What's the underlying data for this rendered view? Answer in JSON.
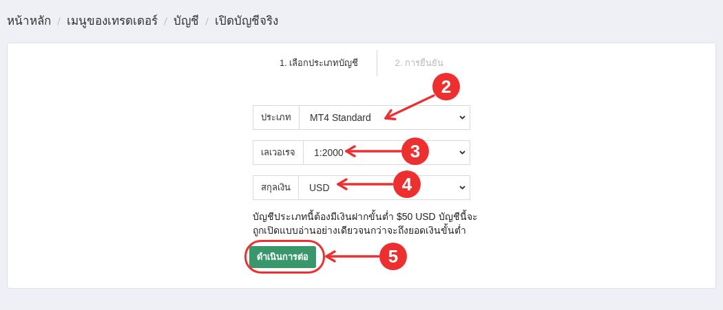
{
  "breadcrumb": [
    "หน้าหลัก",
    "เมนูของเทรดเดอร์",
    "บัญชี",
    "เปิดบัญชีจริง"
  ],
  "steps": [
    {
      "label": "1. เลือกประเภทบัญชี",
      "selected": true
    },
    {
      "label": "2. การยืนยัน",
      "selected": false
    }
  ],
  "fields": [
    {
      "label": "ประเภท",
      "value": "MT4 Standard"
    },
    {
      "label": "เลเวอเรจ",
      "value": "1:2000"
    },
    {
      "label": "สกุลเงิน",
      "value": "USD"
    }
  ],
  "notice": "บัญชีประเภทนี้ต้องมีเงินฝากขั้นต่ำ $50 USD บัญชีนี้จะถูกเปิดแบบอ่านอย่างเดียวจนกว่าจะถึงยอดเงินขั้นต่ำ",
  "continue_button": "ดำเนินการต่อ",
  "annotations": [
    {
      "label": "2"
    },
    {
      "label": "3"
    },
    {
      "label": "4"
    },
    {
      "label": "5"
    }
  ]
}
